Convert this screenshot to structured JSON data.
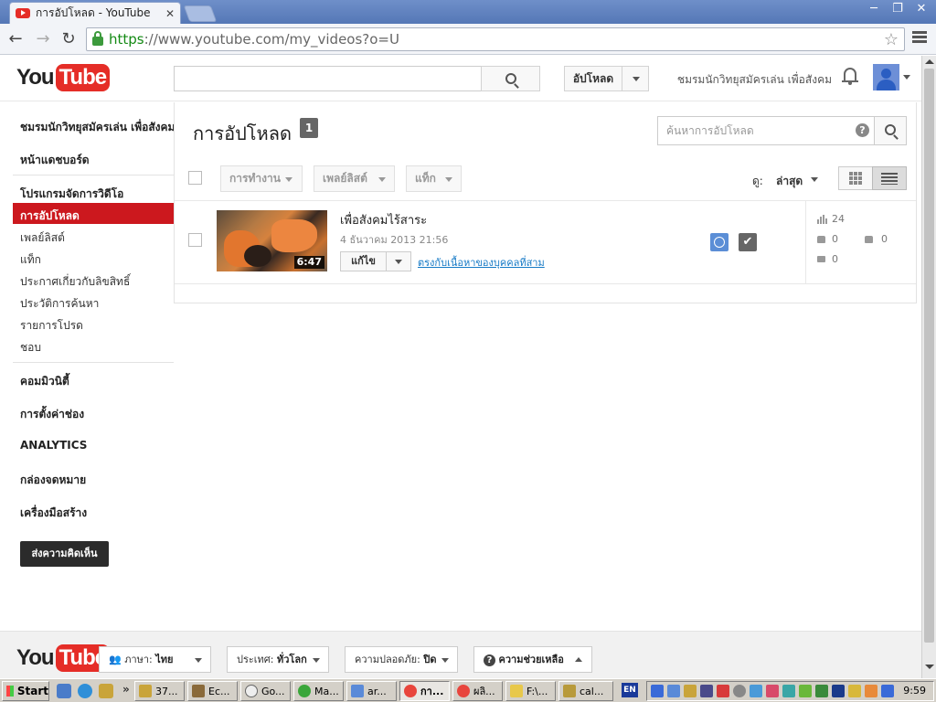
{
  "browser": {
    "tab_title": "การอัปโหลด - YouTube",
    "tab_close": "✕",
    "url_https": "https",
    "url_rest": "://www.youtube.com/my_videos?o=U",
    "window_min": "─",
    "window_max": "❐",
    "window_close": "✕"
  },
  "header": {
    "logo_you": "You",
    "logo_tube": "Tube",
    "upload_label": "อัปโหลด",
    "channel_name": "ชมรมนักวิทยุสมัครเล่น เพื่อสังคม"
  },
  "sidebar": {
    "channel": "ชมรมนักวิทยุสมัครเล่น เพื่อสังคม",
    "dashboard": "หน้าแดชบอร์ด",
    "video_manager": "โปรแกรมจัดการวิดีโอ",
    "uploads": "การอัปโหลด",
    "playlists": "เพลย์ลิสต์",
    "tags": "แท็ก",
    "copyright_notices": "ประกาศเกี่ยวกับลิขสิทธิ์",
    "search_history": "ประวัติการค้นหา",
    "favorites": "รายการโปรด",
    "likes": "ชอบ",
    "community": "คอมมิวนิตี้",
    "channel_settings": "การตั้งค่าช่อง",
    "analytics": "ANALYTICS",
    "inbox": "กล่องจดหมาย",
    "creator_tools": "เครื่องมือสร้าง",
    "feedback": "ส่งความคิดเห็น"
  },
  "main": {
    "title": "การอัปโหลด",
    "count": "1",
    "search_placeholder": "ค้นหาการอัปโหลด",
    "help": "?",
    "filters": [
      "การทำงาน",
      "เพลย์ลิสต์",
      "แท็ก"
    ],
    "sort_label": "ดู:",
    "sort_value": "ล่าสุด"
  },
  "videos": [
    {
      "title": "เพื่อสังคมไร้สาระ",
      "date": "4 ธันวาคม 2013 21:56",
      "duration": "6:47",
      "edit_label": "แก้ไข",
      "claim_link": "ตรงกับเนื้อหาของบุคคลที่สาม",
      "views": "24",
      "likes": "0",
      "dislikes": "0",
      "comments": "0",
      "checkmark": "✔"
    }
  ],
  "footer": {
    "logo_you": "You",
    "logo_tube": "Tube",
    "language_label": "ภาษา:",
    "language_value": "ไทย",
    "country_label": "ประเทศ:",
    "country_value": "ทั่วโลก",
    "safety_label": "ความปลอดภัย:",
    "safety_value": "ปิด",
    "help_label": "ความช่วยเหลือ",
    "help_icon": "?"
  },
  "taskbar": {
    "start": "Start",
    "more": "»",
    "items": [
      "37...",
      "Ec...",
      "Go...",
      "Ma...",
      "ar...",
      "กา...",
      "ผลิ...",
      "F:\\...",
      "cal..."
    ],
    "lang": "EN",
    "clock": "9:59"
  },
  "colors": {
    "youtube_red": "#e52d27",
    "active_nav": "#cc181e",
    "link": "#167ac6"
  }
}
